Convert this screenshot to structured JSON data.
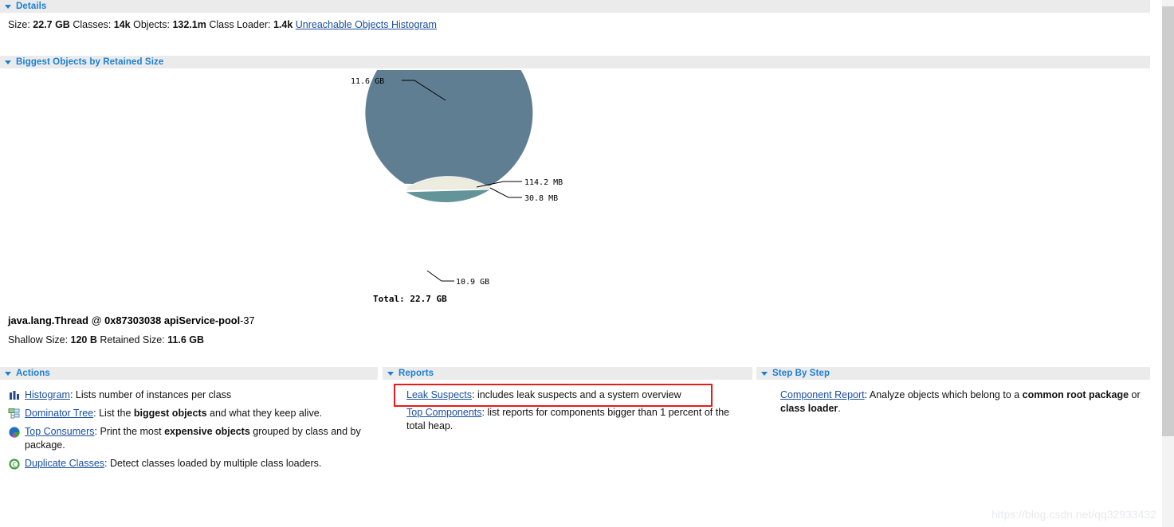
{
  "sections": {
    "details": {
      "title": "Details"
    },
    "biggest": {
      "title": "Biggest Objects by Retained Size"
    },
    "actions": {
      "title": "Actions"
    },
    "reports": {
      "title": "Reports"
    },
    "stepbystep": {
      "title": "Step By Step"
    }
  },
  "details": {
    "size_label": "Size:",
    "size_value": "22.7 GB",
    "classes_label": "Classes:",
    "classes_value": "14k",
    "objects_label": "Objects:",
    "objects_value": "132.1m",
    "classloader_label": "Class Loader:",
    "classloader_value": "1.4k",
    "unreachable_link": "Unreachable Objects Histogram"
  },
  "chart_data": {
    "type": "pie",
    "title": "Biggest Objects by Retained Size",
    "total_label": "Total: 22.7 GB",
    "total_value_bytes": 22700000000,
    "unit_note": "Slice labels show retained size",
    "categories": [
      "11.6 GB",
      "114.2 MB",
      "30.8 MB",
      "10.9 GB"
    ],
    "values": [
      11.6,
      0.1142,
      0.0308,
      10.9
    ],
    "value_units": [
      "GB",
      "MB",
      "MB",
      "GB"
    ],
    "labels": [
      "11.6 GB",
      "114.2 MB",
      "30.8 MB",
      "10.9 GB"
    ],
    "colors": [
      "#5f7e92",
      "#f2f2ee",
      "#e8e8e0",
      "#63949a"
    ],
    "legend": "none",
    "grid": false
  },
  "selected_object": {
    "class_name": "java.lang.Thread",
    "at": "@",
    "address": "0x87303038",
    "thread_name_bold": "apiService-pool",
    "thread_name_rest": "-37",
    "shallow_label": "Shallow Size:",
    "shallow_value": "120 B",
    "retained_label": "Retained Size:",
    "retained_value": "11.6 GB"
  },
  "actions": [
    {
      "icon": "histogram-icon",
      "link": "Histogram",
      "desc_1": ": Lists number of instances per class",
      "bold": "",
      "desc_2": ""
    },
    {
      "icon": "dominator-tree-icon",
      "link": "Dominator Tree",
      "desc_1": ": List the ",
      "bold": "biggest objects",
      "desc_2": " and what they keep alive."
    },
    {
      "icon": "top-consumers-icon",
      "link": "Top Consumers",
      "desc_1": ": Print the most ",
      "bold": "expensive objects",
      "desc_2": " grouped by class and by package."
    },
    {
      "icon": "duplicate-classes-icon",
      "link": "Duplicate Classes",
      "desc_1": ": Detect classes loaded by multiple class loaders.",
      "bold": "",
      "desc_2": ""
    }
  ],
  "reports": [
    {
      "link": "Leak Suspects",
      "desc_1": ": includes leak suspects and a system overview",
      "bold": "",
      "desc_2": "",
      "highlighted": true
    },
    {
      "link": "Top Components",
      "desc_1": ": list reports for components bigger than 1 percent of the total heap.",
      "bold": "",
      "desc_2": "",
      "highlighted": false
    }
  ],
  "stepbystep": [
    {
      "link": "Component Report",
      "desc_1": ": Analyze objects which belong to a ",
      "bold": "common root package",
      "desc_2": " or ",
      "bold2": "class loader",
      "desc_3": "."
    }
  ],
  "watermark": "https://blog.csdn.net/qq32933432",
  "colors": {
    "header_text": "#1a7fd4",
    "header_bg": "#ebebeb",
    "link": "#1a4fa0",
    "highlight": "#e81a1a",
    "pie_slice_1": "#5f7e92",
    "pie_slice_4": "#63949a"
  }
}
